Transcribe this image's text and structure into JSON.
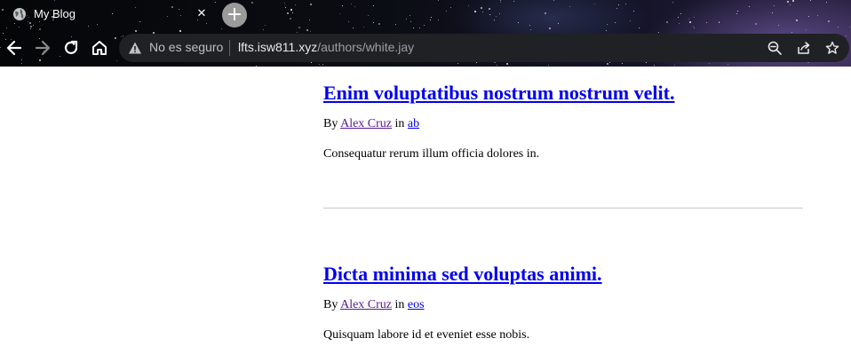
{
  "browser": {
    "tab": {
      "title": "My Blog",
      "favicon": "globe-icon",
      "close": "✕"
    },
    "new_tab_label": "+",
    "nav": {
      "back": "arrow-left-icon",
      "forward": "arrow-right-icon",
      "reload": "reload-icon",
      "home": "home-icon"
    },
    "omnibox": {
      "security_label": "No es seguro",
      "url_host": "lfts.isw811.xyz",
      "url_path": "/authors/white.jay",
      "icons": [
        "zoom-out-icon",
        "share-icon",
        "star-icon"
      ]
    },
    "colors": {
      "omnibox_bg": "#202124",
      "accent_link": "#0000ee",
      "visited_link": "#551a8b"
    }
  },
  "posts": [
    {
      "title": "Enim voluptatibus nostrum nostrum velit.",
      "by": "By",
      "author": "Alex Cruz",
      "in": "in",
      "category": "ab",
      "excerpt": "Consequatur rerum illum officia dolores in."
    },
    {
      "title": "Dicta minima sed voluptas animi.",
      "by": "By",
      "author": "Alex Cruz",
      "in": "in",
      "category": "eos",
      "excerpt": "Quisquam labore id et eveniet esse nobis."
    }
  ]
}
